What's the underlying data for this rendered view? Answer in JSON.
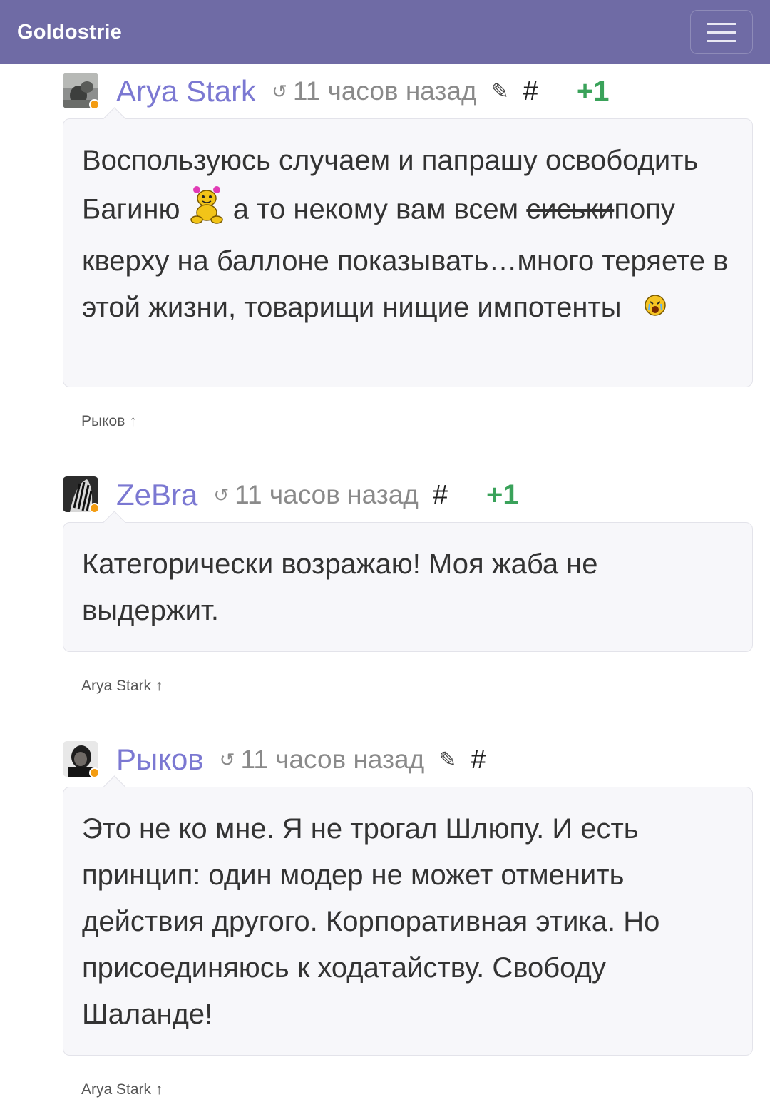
{
  "navbar": {
    "brand": "Goldostrie",
    "menu_icon": "hamburger-menu-icon"
  },
  "comments": [
    {
      "author": "Arya Stark",
      "time": "11 часов назад",
      "has_edit": true,
      "hash": "#",
      "score": "+1",
      "text_parts": [
        "Воспользуюсь случаем и папрашу освободить Багиню",
        "а то некому вам всем",
        "сиськи",
        "попу кверху на баллоне показывать…много теряете в этой жизни, товарищи нищие импотенты"
      ],
      "reply_to": "Рыков ↑"
    },
    {
      "author": "ZeBra",
      "time": "11 часов назад",
      "has_edit": false,
      "hash": "#",
      "score": "+1",
      "text": "Категорически возражаю! Моя жаба не выдержит.",
      "reply_to": "Arya Stark ↑"
    },
    {
      "author": "Рыков",
      "time": "11 часов назад",
      "has_edit": true,
      "hash": "#",
      "score": "",
      "text": "Это не ко мне. Я не трогал Шлюпу. И есть принцип: один модер не может отменить действия другого. Корпоративная этика. Но присоединяюсь к ходатайству. Свободу Шаланде!",
      "reply_to": "Arya Stark ↑"
    }
  ],
  "colors": {
    "navbar": "#6f6ba5",
    "author": "#7b78d2",
    "score": "#3aa25a",
    "online_dot": "#f39c12"
  }
}
